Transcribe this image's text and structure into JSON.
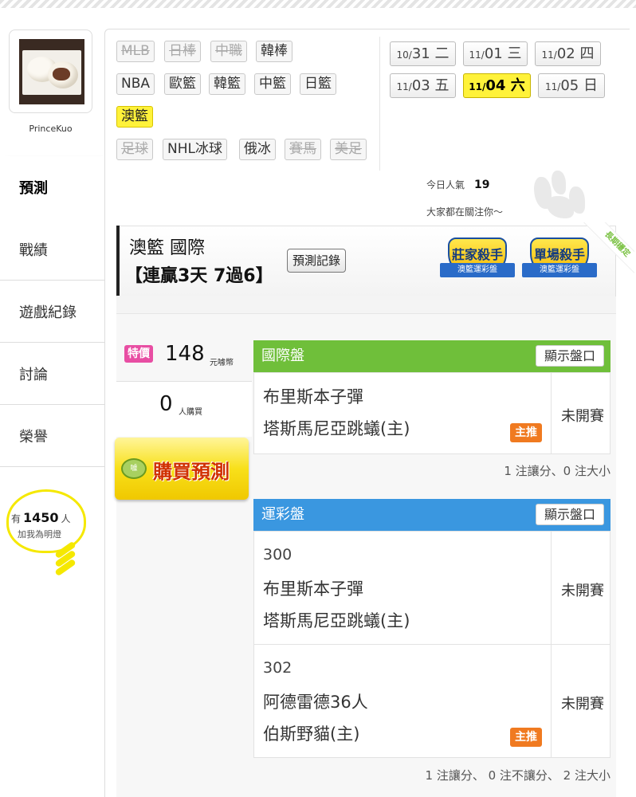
{
  "profile": {
    "username": "PrinceKuo"
  },
  "sidebar": {
    "items": [
      {
        "label": "預測"
      },
      {
        "label": "戰績"
      },
      {
        "label": "遊戲紀錄"
      },
      {
        "label": "討論"
      },
      {
        "label": "榮譽"
      }
    ]
  },
  "fans": {
    "prefix": "有",
    "count": "1450",
    "suffix": "人",
    "caption": "加我為明燈"
  },
  "sports": {
    "row1": [
      "MLB",
      "日棒",
      "中職",
      "韓棒"
    ],
    "row2": [
      "NBA",
      "歐籃",
      "韓籃",
      "中籃",
      "日籃"
    ],
    "row3": [
      "澳籃"
    ],
    "row4": [
      "足球",
      "NHL冰球",
      "俄冰",
      "賽馬",
      "美足"
    ]
  },
  "dates": [
    {
      "md_small": "10/",
      "md": "31",
      "dow": "二"
    },
    {
      "md_small": "11/",
      "md": "01",
      "dow": "三"
    },
    {
      "md_small": "11/",
      "md": "02",
      "dow": "四"
    },
    {
      "md_small": "11/",
      "md": "03",
      "dow": "五"
    },
    {
      "md_small": "11/",
      "md": "04",
      "dow": "六"
    },
    {
      "md_small": "11/",
      "md": "05",
      "dow": "日"
    }
  ],
  "popularity": {
    "label": "今日人氣",
    "count": "19",
    "subtitle": "大家都在關注你～"
  },
  "header": {
    "title": "澳籃 國際",
    "streak": "【連贏3天 7過6】",
    "history_button": "預測記錄",
    "badge1": {
      "title": "莊家殺手",
      "ribbon": "澳籃運彩盤"
    },
    "badge2": {
      "title": "單場殺手",
      "ribbon": "澳籃運彩盤"
    },
    "corner": "長期穩定"
  },
  "pricing": {
    "tag": "特價",
    "price": "148",
    "unit": "元噱幣",
    "buyers": "0",
    "buyers_unit": "人購買",
    "buy_label": "購買預測",
    "coin_text": "噱"
  },
  "intl_panel": {
    "title": "國際盤",
    "show_button": "顯示盤口",
    "games": [
      {
        "away": "布里斯本子彈",
        "home": "塔斯馬尼亞跳蟻(主)",
        "status": "未開賽",
        "pick": "主推"
      }
    ],
    "summary": "1 注讓分、0 注大小"
  },
  "sports_lottery_panel": {
    "title": "運彩盤",
    "show_button": "顯示盤口",
    "games": [
      {
        "code": "300",
        "away": "布里斯本子彈",
        "home": "塔斯馬尼亞跳蟻(主)",
        "status": "未開賽"
      },
      {
        "code": "302",
        "away": "阿德雷德36人",
        "home": "伯斯野貓(主)",
        "status": "未開賽",
        "pick": "主推"
      }
    ],
    "summary": "1 注讓分、 0 注不讓分、 2 注大小"
  },
  "colors": {
    "accent_yellow": "#fff23a",
    "green_header": "#6fbf3a",
    "blue_header": "#3a97e0",
    "pick_orange": "#f07a20",
    "sale_pink": "#e84ea3"
  }
}
